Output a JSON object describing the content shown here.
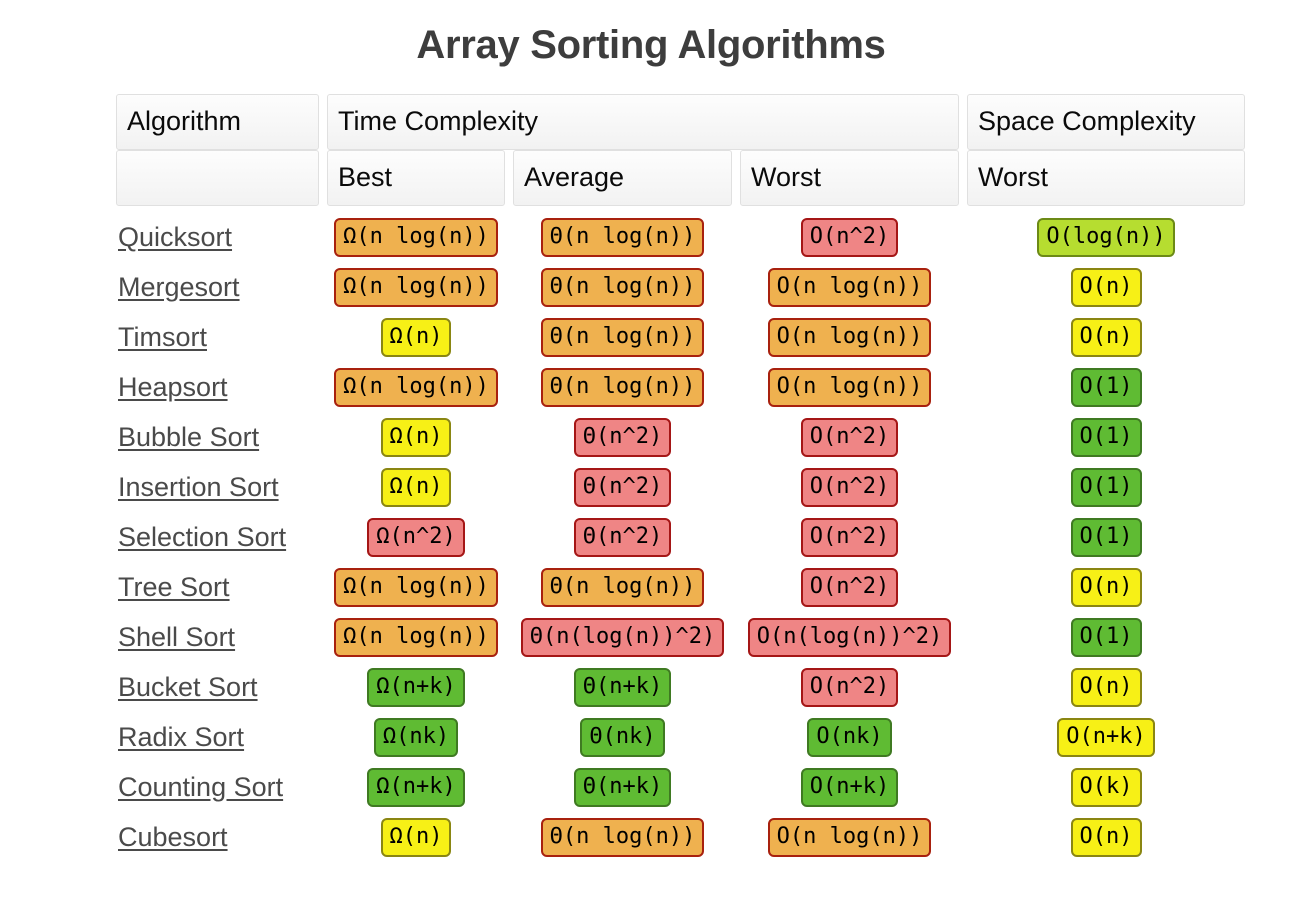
{
  "title": "Array Sorting Algorithms",
  "table": {
    "group_headers": [
      {
        "label": "Algorithm",
        "key": "algorithm"
      },
      {
        "label": "Time Complexity",
        "key": "time"
      },
      {
        "label": "Space Complexity",
        "key": "space"
      }
    ],
    "sub_headers": [
      {
        "label": ""
      },
      {
        "label": "Best"
      },
      {
        "label": "Average"
      },
      {
        "label": "Worst"
      },
      {
        "label": "Worst"
      }
    ],
    "colors": {
      "green": "#5fbb33",
      "lime": "#b6dd30",
      "yellow": "#f7f016",
      "orange": "#efb14f",
      "red": "#ef8585",
      "green_border": "#3f7a22",
      "lime_border": "#6c8a16",
      "yellow_border": "#8a8612",
      "orange_border": "#a8210e",
      "red_border": "#a51616",
      "title_color": "#3d3d3d",
      "algorithm_link_color": "#4a4a4a"
    },
    "rows": [
      {
        "algorithm": "Quicksort",
        "best": {
          "text": "Ω(n log(n))",
          "color": "orange"
        },
        "average": {
          "text": "Θ(n log(n))",
          "color": "orange"
        },
        "worst": {
          "text": "O(n^2)",
          "color": "red"
        },
        "space": {
          "text": "O(log(n))",
          "color": "lime"
        }
      },
      {
        "algorithm": "Mergesort",
        "best": {
          "text": "Ω(n log(n))",
          "color": "orange"
        },
        "average": {
          "text": "Θ(n log(n))",
          "color": "orange"
        },
        "worst": {
          "text": "O(n log(n))",
          "color": "orange"
        },
        "space": {
          "text": "O(n)",
          "color": "yellow"
        }
      },
      {
        "algorithm": "Timsort",
        "best": {
          "text": "Ω(n)",
          "color": "yellow"
        },
        "average": {
          "text": "Θ(n log(n))",
          "color": "orange"
        },
        "worst": {
          "text": "O(n log(n))",
          "color": "orange"
        },
        "space": {
          "text": "O(n)",
          "color": "yellow"
        }
      },
      {
        "algorithm": "Heapsort",
        "best": {
          "text": "Ω(n log(n))",
          "color": "orange"
        },
        "average": {
          "text": "Θ(n log(n))",
          "color": "orange"
        },
        "worst": {
          "text": "O(n log(n))",
          "color": "orange"
        },
        "space": {
          "text": "O(1)",
          "color": "green"
        }
      },
      {
        "algorithm": "Bubble Sort",
        "best": {
          "text": "Ω(n)",
          "color": "yellow"
        },
        "average": {
          "text": "Θ(n^2)",
          "color": "red"
        },
        "worst": {
          "text": "O(n^2)",
          "color": "red"
        },
        "space": {
          "text": "O(1)",
          "color": "green"
        }
      },
      {
        "algorithm": "Insertion Sort",
        "best": {
          "text": "Ω(n)",
          "color": "yellow"
        },
        "average": {
          "text": "Θ(n^2)",
          "color": "red"
        },
        "worst": {
          "text": "O(n^2)",
          "color": "red"
        },
        "space": {
          "text": "O(1)",
          "color": "green"
        }
      },
      {
        "algorithm": "Selection Sort",
        "best": {
          "text": "Ω(n^2)",
          "color": "red"
        },
        "average": {
          "text": "Θ(n^2)",
          "color": "red"
        },
        "worst": {
          "text": "O(n^2)",
          "color": "red"
        },
        "space": {
          "text": "O(1)",
          "color": "green"
        }
      },
      {
        "algorithm": "Tree Sort",
        "best": {
          "text": "Ω(n log(n))",
          "color": "orange"
        },
        "average": {
          "text": "Θ(n log(n))",
          "color": "orange"
        },
        "worst": {
          "text": "O(n^2)",
          "color": "red"
        },
        "space": {
          "text": "O(n)",
          "color": "yellow"
        }
      },
      {
        "algorithm": "Shell Sort",
        "best": {
          "text": "Ω(n log(n))",
          "color": "orange"
        },
        "average": {
          "text": "Θ(n(log(n))^2)",
          "color": "red"
        },
        "worst": {
          "text": "O(n(log(n))^2)",
          "color": "red"
        },
        "space": {
          "text": "O(1)",
          "color": "green"
        }
      },
      {
        "algorithm": "Bucket Sort",
        "best": {
          "text": "Ω(n+k)",
          "color": "green"
        },
        "average": {
          "text": "Θ(n+k)",
          "color": "green"
        },
        "worst": {
          "text": "O(n^2)",
          "color": "red"
        },
        "space": {
          "text": "O(n)",
          "color": "yellow"
        }
      },
      {
        "algorithm": "Radix Sort",
        "best": {
          "text": "Ω(nk)",
          "color": "green"
        },
        "average": {
          "text": "Θ(nk)",
          "color": "green"
        },
        "worst": {
          "text": "O(nk)",
          "color": "green"
        },
        "space": {
          "text": "O(n+k)",
          "color": "yellow"
        }
      },
      {
        "algorithm": "Counting Sort",
        "best": {
          "text": "Ω(n+k)",
          "color": "green"
        },
        "average": {
          "text": "Θ(n+k)",
          "color": "green"
        },
        "worst": {
          "text": "O(n+k)",
          "color": "green"
        },
        "space": {
          "text": "O(k)",
          "color": "yellow"
        }
      },
      {
        "algorithm": "Cubesort",
        "best": {
          "text": "Ω(n)",
          "color": "yellow"
        },
        "average": {
          "text": "Θ(n log(n))",
          "color": "orange"
        },
        "worst": {
          "text": "O(n log(n))",
          "color": "orange"
        },
        "space": {
          "text": "O(n)",
          "color": "yellow"
        }
      }
    ]
  }
}
